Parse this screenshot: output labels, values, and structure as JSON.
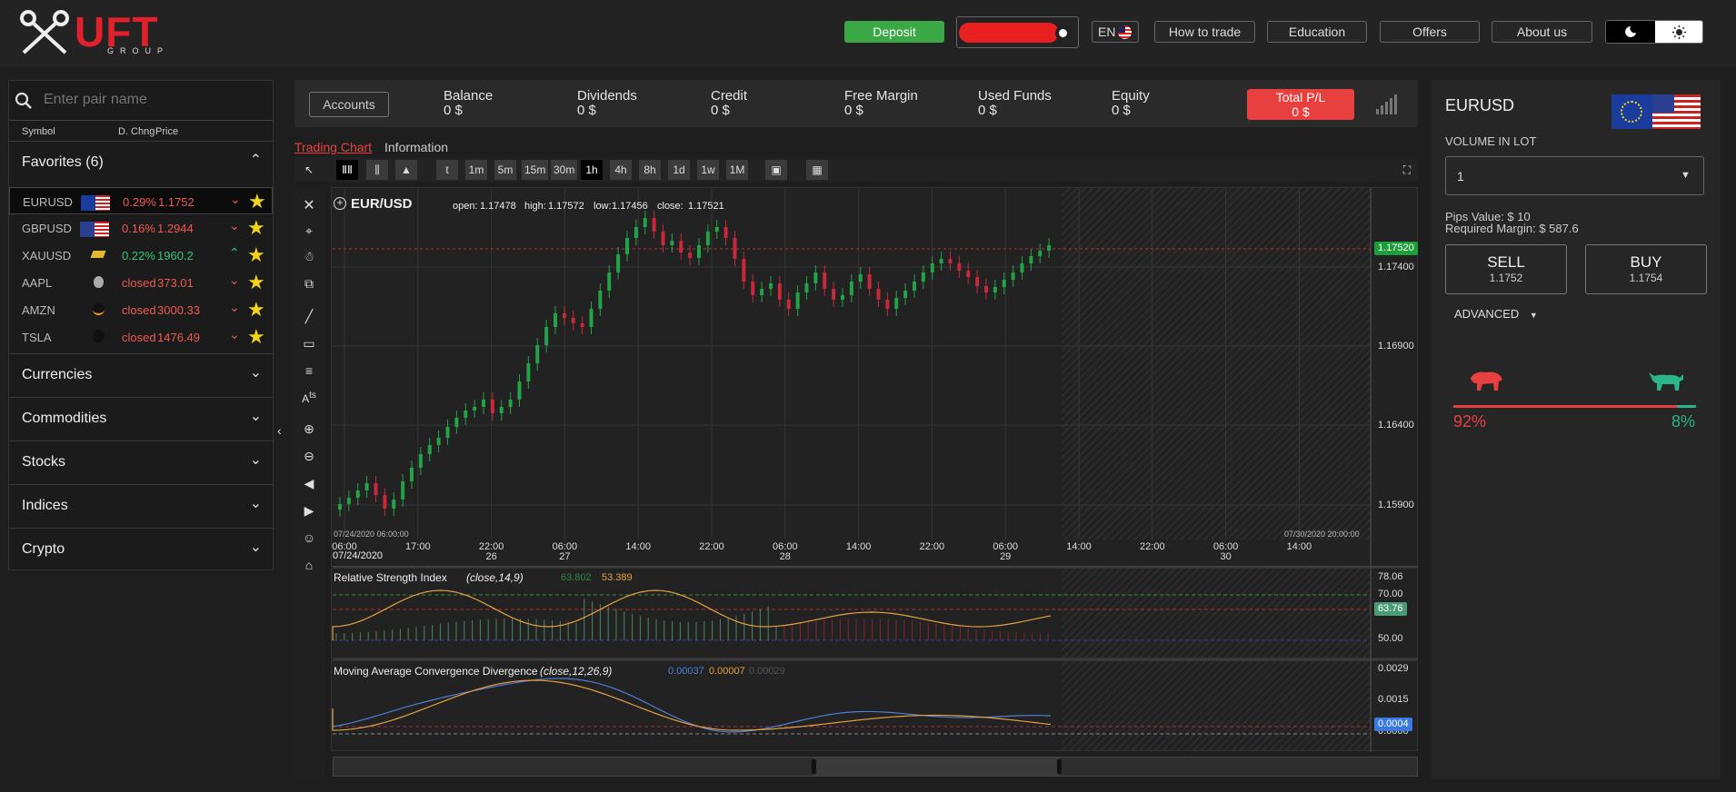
{
  "header": {
    "logo_text": "UFT",
    "logo_sub": "GROUP",
    "deposit": "Deposit",
    "lang": "EN",
    "how_to_trade": "How to trade",
    "education": "Education",
    "offers": "Offers",
    "about_us": "About us"
  },
  "left": {
    "search_placeholder": "Enter pair name",
    "col_symbol": "Symbol",
    "col_dchng": "D. Chng",
    "col_price": "Price",
    "favorites": "Favorites (6)",
    "rows": [
      {
        "symbol": "EURUSD",
        "change": "0.29%",
        "price": "1.1752",
        "dir": "down",
        "color": "red"
      },
      {
        "symbol": "GBPUSD",
        "change": "0.16%",
        "price": "1.2944",
        "dir": "down",
        "color": "red"
      },
      {
        "symbol": "XAUUSD",
        "change": "0.22%",
        "price": "1960.2",
        "dir": "up",
        "color": "green"
      },
      {
        "symbol": "AAPL",
        "change": "closed",
        "price": "373.01",
        "dir": "down",
        "color": "red"
      },
      {
        "symbol": "AMZN",
        "change": "closed",
        "price": "3000.33",
        "dir": "down",
        "color": "red"
      },
      {
        "symbol": "TSLA",
        "change": "closed",
        "price": "1476.49",
        "dir": "down",
        "color": "red"
      }
    ],
    "sections": [
      "Currencies",
      "Commodities",
      "Stocks",
      "Indices",
      "Crypto"
    ]
  },
  "account": {
    "accounts_btn": "Accounts",
    "balance_label": "Balance",
    "balance": "0 $",
    "dividends_label": "Dividends",
    "dividends": "0 $",
    "credit_label": "Credit",
    "credit": "0 $",
    "free_margin_label": "Free Margin",
    "free_margin": "0 $",
    "used_funds_label": "Used Funds",
    "used_funds": "0 $",
    "equity_label": "Equity",
    "equity": "0 $",
    "total_pl_label": "Total P/L",
    "total_pl": "0 $"
  },
  "tabs": {
    "chart": "Trading Chart",
    "info": "Information"
  },
  "timeframes": [
    "t",
    "1m",
    "5m",
    "15m",
    "30m",
    "1h",
    "4h",
    "8h",
    "1d",
    "1w",
    "1M"
  ],
  "chart": {
    "symbol": "EUR/USD",
    "open_label": "open:",
    "open": "1.17478",
    "high_label": "high:",
    "high": "1.17572",
    "low_label": "low:",
    "low": "1.17456",
    "close_label": "close:",
    "close": "1.17521",
    "last_price": "1.17520",
    "y_ticks": [
      "1.17400",
      "1.16900",
      "1.16400",
      "1.15900"
    ],
    "x_ticks": [
      {
        "t": "06:00",
        "d": ""
      },
      {
        "t": "17:00",
        "d": ""
      },
      {
        "t": "22:00",
        "d": "26"
      },
      {
        "t": "06:00",
        "d": "27"
      },
      {
        "t": "14:00",
        "d": ""
      },
      {
        "t": "22:00",
        "d": ""
      },
      {
        "t": "06:00",
        "d": "28"
      },
      {
        "t": "14:00",
        "d": ""
      },
      {
        "t": "22:00",
        "d": ""
      },
      {
        "t": "06:00",
        "d": "29"
      },
      {
        "t": "14:00",
        "d": ""
      },
      {
        "t": "22:00",
        "d": ""
      },
      {
        "t": "06:00",
        "d": "30"
      },
      {
        "t": "14:00",
        "d": ""
      }
    ],
    "start_date": "07/24/2020",
    "start_time_label": "07/24/2020 06:00:00",
    "end_time_label": "07/30/2020 20:00:00",
    "rsi_title": "Relative Strength Index",
    "rsi_params": "(close,14,9)",
    "rsi_v1": "63.802",
    "rsi_v2": "53.389",
    "rsi_ticks": [
      "78.06",
      "70.00",
      "50.00"
    ],
    "rsi_last": "63.76",
    "macd_title": "Moving Average Convergence Divergence",
    "macd_params": "(close,12,26,9)",
    "macd_v1": "0.00037",
    "macd_v2": "0.00007",
    "macd_v3": "0.00029",
    "macd_ticks": [
      "0.0029",
      "0.0015",
      "0.0000"
    ],
    "macd_last": "0.0004"
  },
  "right": {
    "symbol": "EURUSD",
    "volume_label": "VOLUME IN LOT",
    "volume": "1",
    "pips_value": "Pips Value: $ 10",
    "required_margin": "Required Margin: $ 587.6",
    "sell_label": "SELL",
    "sell_price": "1.1752",
    "buy_label": "BUY",
    "buy_price": "1.1754",
    "advanced": "ADVANCED",
    "bear_pct": "92%",
    "bull_pct": "8%"
  },
  "colors": {
    "accent_red": "#e8403f",
    "green": "#3aa844",
    "star": "#f2d21b",
    "bull": "#2bb38a"
  }
}
